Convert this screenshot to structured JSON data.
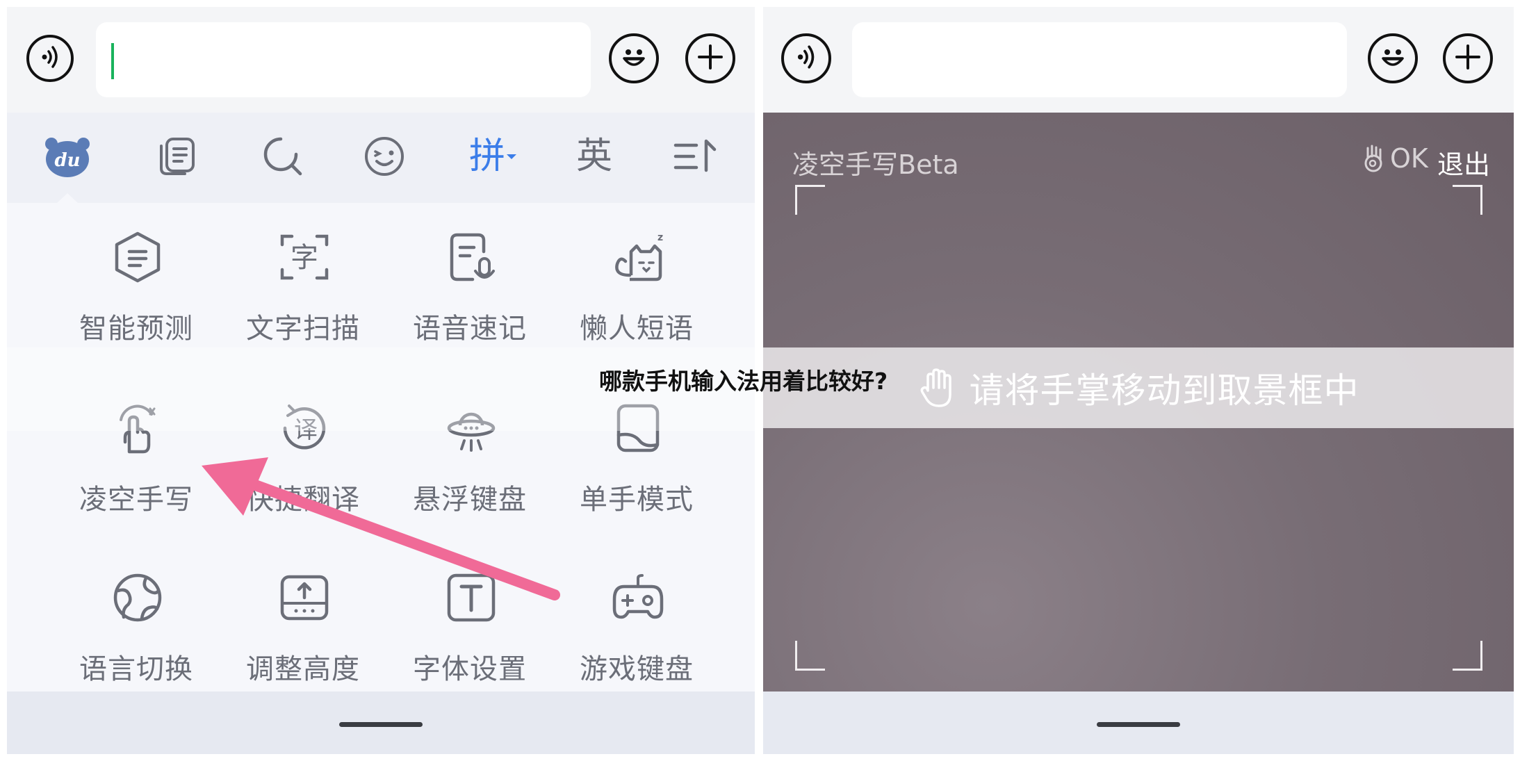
{
  "overlay_title": "哪款手机输入法用着比较好?",
  "colors": {
    "accent_blue": "#3b7de9",
    "cursor_green": "#19b35c",
    "arrow_pink": "#f06a97",
    "icon_gray": "#6b6e78"
  },
  "left_panel": {
    "topbar": {
      "voice_icon": "voice-icon",
      "input_value": "",
      "emoji_icon": "emoji-icon",
      "plus_icon": "plus-icon"
    },
    "toolbar": {
      "logo_text": "du",
      "clipboard_icon": "clipboard-icon",
      "search_icon": "search-icon",
      "sticker_icon": "wink-icon",
      "pinyin_label": "拼",
      "english_label": "英",
      "menu_icon": "list-sort-icon"
    },
    "grid": [
      {
        "label": "智能预测",
        "icon": "predict-icon"
      },
      {
        "label": "文字扫描",
        "icon": "text-scan-icon"
      },
      {
        "label": "语音速记",
        "icon": "voice-note-icon"
      },
      {
        "label": "懒人短语",
        "icon": "lazy-cat-icon"
      },
      {
        "label": "凌空手写",
        "icon": "air-handwrite-icon"
      },
      {
        "label": "快捷翻译",
        "icon": "translate-icon"
      },
      {
        "label": "悬浮键盘",
        "icon": "floating-keyboard-icon"
      },
      {
        "label": "单手模式",
        "icon": "one-hand-icon"
      },
      {
        "label": "语言切换",
        "icon": "globe-icon"
      },
      {
        "label": "调整高度",
        "icon": "adjust-height-icon"
      },
      {
        "label": "字体设置",
        "icon": "font-icon"
      },
      {
        "label": "游戏键盘",
        "icon": "gamepad-icon"
      }
    ]
  },
  "right_panel": {
    "camera_title": "凌空手写Beta",
    "ok_label": "OK",
    "exit_label": "退出",
    "hint": "请将手掌移动到取景框中"
  }
}
